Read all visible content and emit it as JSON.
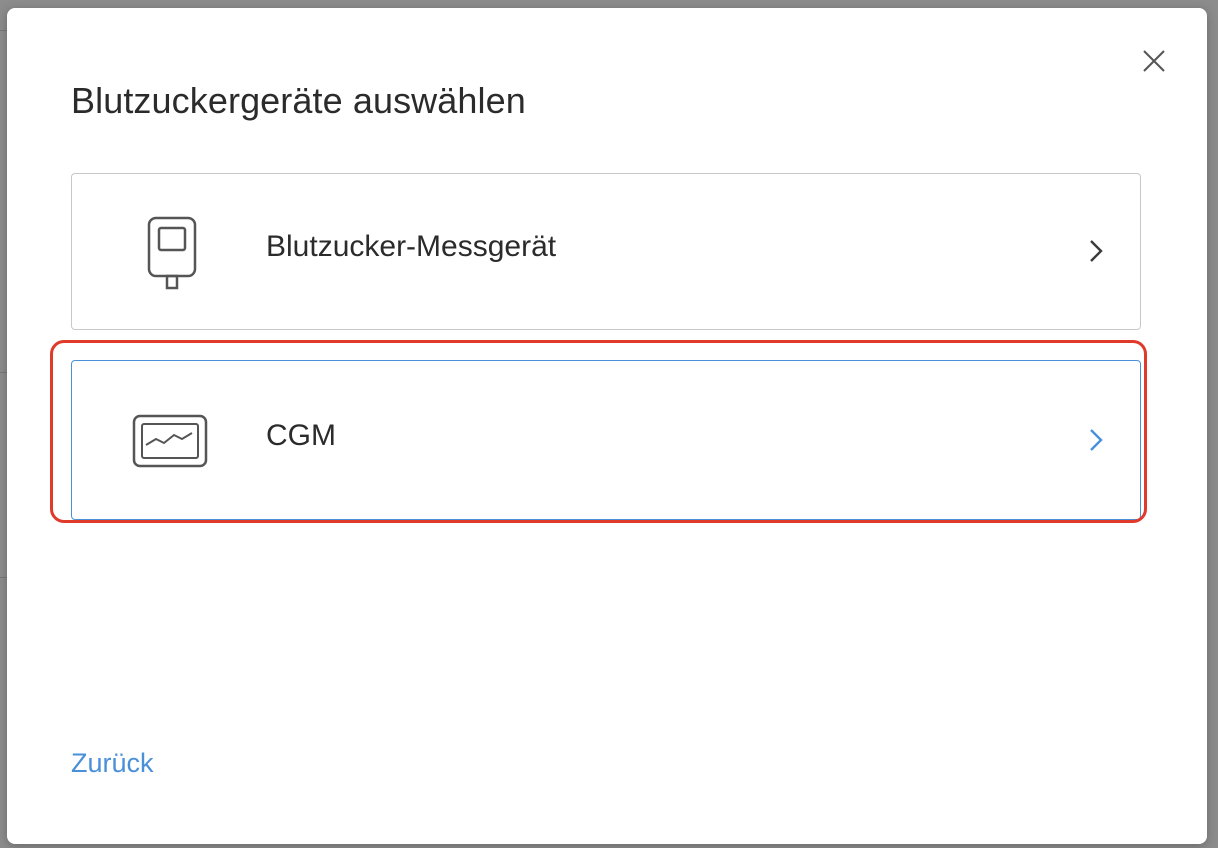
{
  "modal": {
    "title": "Blutzuckergeräte auswählen",
    "close_icon": "close-icon",
    "back_label": "Zurück"
  },
  "options": [
    {
      "label": "Blutzucker-Messgerät",
      "icon": "blood-glucose-meter-icon",
      "chevron_color": "#3a3a3a"
    },
    {
      "label": "CGM",
      "icon": "cgm-monitor-icon",
      "chevron_color": "#4a90d9"
    }
  ],
  "colors": {
    "accent": "#4a90d9",
    "highlight": "#e03a2a",
    "text": "#2b2b2b",
    "border": "#c9c9c9"
  }
}
